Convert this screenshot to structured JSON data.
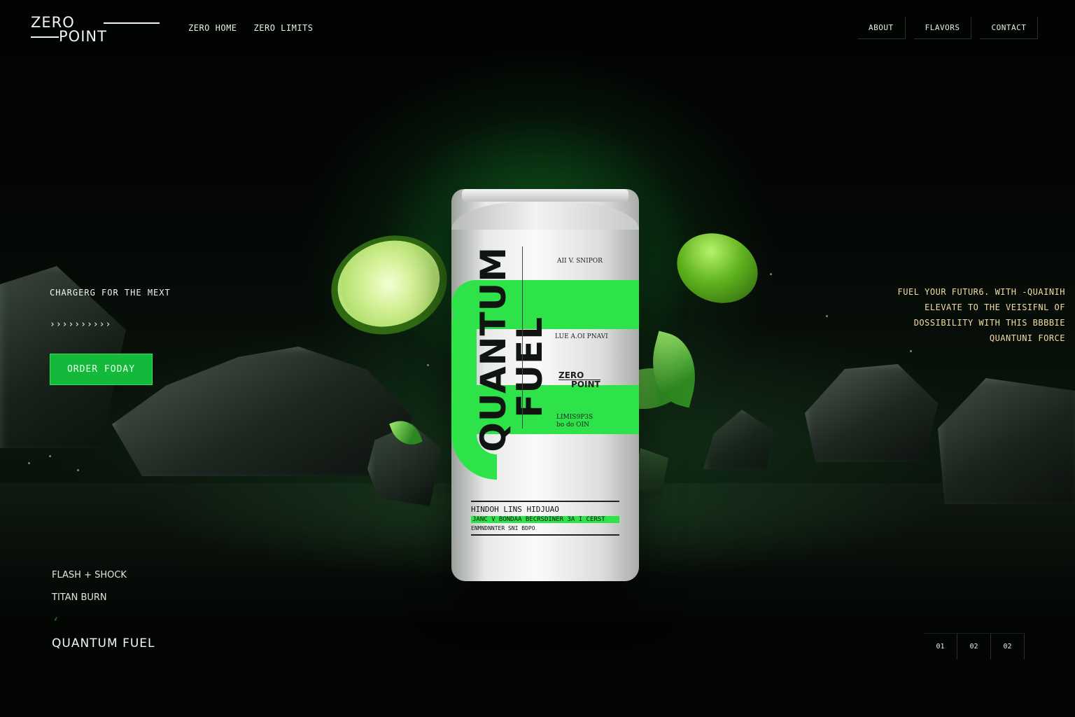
{
  "brand": {
    "line1": "ZERO",
    "line2": "POINT"
  },
  "nav_left": [
    "ZERO HOME",
    "ZERO LIMITS"
  ],
  "nav_right": [
    "ABOUT",
    "FLAVORS",
    "CONTACT"
  ],
  "hero": {
    "tagline": "CHARGERG FOR THE MEXT",
    "chevrons": "››››››››››",
    "cta_label": "ORDER FODAY"
  },
  "right_copy": [
    "FUEL YOUR FUTUR6. WITH -QUAINIH",
    "ELEVATE TO THE VEISIFNL OF",
    "DOSSIBILITY WITH THIS BBBBIE",
    "QUANTUNI  FORCE"
  ],
  "can": {
    "title_word1": "QUANTUM",
    "title_word2": "FUEL",
    "small_text_1": "AII V. SNIPOR",
    "small_text_2": "LUE A.OI PNAVI",
    "small_text_3": "LIMIS9P3S",
    "small_text_4": "bo do OIN",
    "logo_line1": "ZERO",
    "logo_line2": "POINT",
    "label_title": "HINDOH LINS HIDJUAO",
    "label_highlight": "JANC V BONDAA BECRSDINER 3A I CERST",
    "label_small": "ENMNDNNTER SNI BDPO"
  },
  "flavors": [
    "FLASH + SHOCK",
    "TITAN BURN"
  ],
  "flavor_marker": "⸙",
  "current_flavor": "QUANTUM FUEL",
  "pager": [
    "01",
    "02",
    "02"
  ],
  "colors": {
    "accent": "#2ee34a",
    "button": "#12b93a",
    "copy_right": "#f4dca0",
    "background": "#050805"
  }
}
